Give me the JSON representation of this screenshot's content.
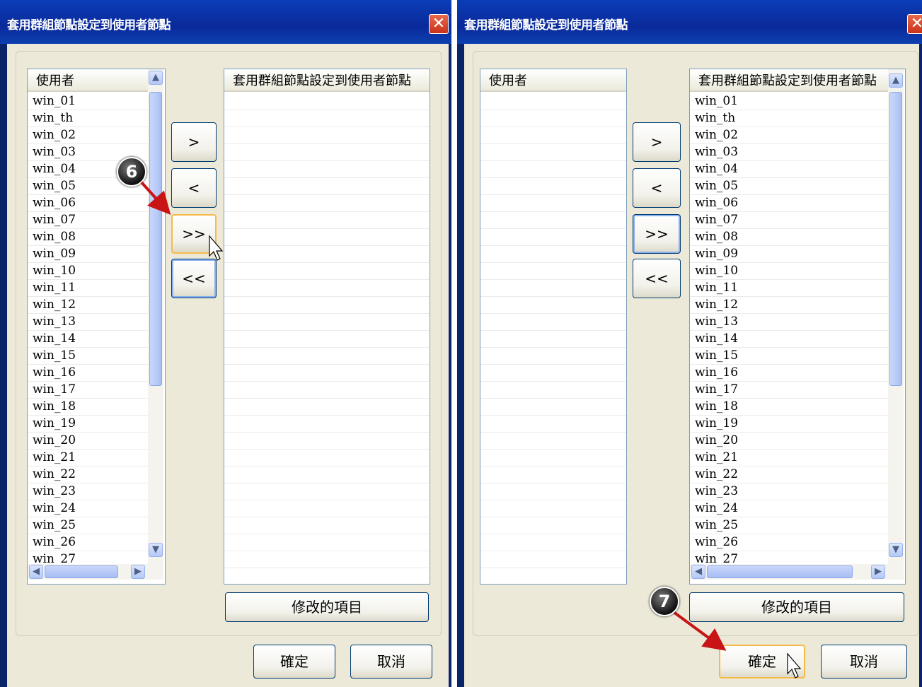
{
  "dialogs": [
    {
      "title": "套用群組節點設定到使用者節點",
      "close_glyph": "✕",
      "left_list_header": "使用者",
      "left_list_items": [
        "win_01",
        "win_th",
        "win_02",
        "win_03",
        "win_04",
        "win_05",
        "win_06",
        "win_07",
        "win_08",
        "win_09",
        "win_10",
        "win_11",
        "win_12",
        "win_13",
        "win_14",
        "win_15",
        "win_16",
        "win_17",
        "win_18",
        "win_19",
        "win_20",
        "win_21",
        "win_22",
        "win_23",
        "win_24",
        "win_25",
        "win_26",
        "win_27"
      ],
      "right_list_header": "套用群組節點設定到使用者節點",
      "right_list_items": [],
      "move_buttons": [
        ">",
        "<",
        ">>",
        "<<"
      ],
      "modified_items_label": "修改的項目",
      "ok_label": "確定",
      "cancel_label": "取消",
      "step_marker": "6"
    },
    {
      "title": "套用群組節點設定到使用者節點",
      "close_glyph": "✕",
      "left_list_header": "使用者",
      "left_list_items": [],
      "right_list_header": "套用群組節點設定到使用者節點",
      "right_list_items": [
        "win_01",
        "win_th",
        "win_02",
        "win_03",
        "win_04",
        "win_05",
        "win_06",
        "win_07",
        "win_08",
        "win_09",
        "win_10",
        "win_11",
        "win_12",
        "win_13",
        "win_14",
        "win_15",
        "win_16",
        "win_17",
        "win_18",
        "win_19",
        "win_20",
        "win_21",
        "win_22",
        "win_23",
        "win_24",
        "win_25",
        "win_26",
        "win_27"
      ],
      "move_buttons": [
        ">",
        "<",
        ">>",
        "<<"
      ],
      "modified_items_label": "修改的項目",
      "ok_label": "確定",
      "cancel_label": "取消",
      "step_marker": "7"
    }
  ],
  "scroll_glyphs": {
    "up": "▲",
    "down": "▼",
    "left": "◀",
    "right": "▶"
  },
  "colors": {
    "title_bar": "#0a2a9a",
    "dialog_bg": "#ece9d8",
    "hover_border": "#f5bb4a",
    "arrow_red": "#c81414"
  }
}
